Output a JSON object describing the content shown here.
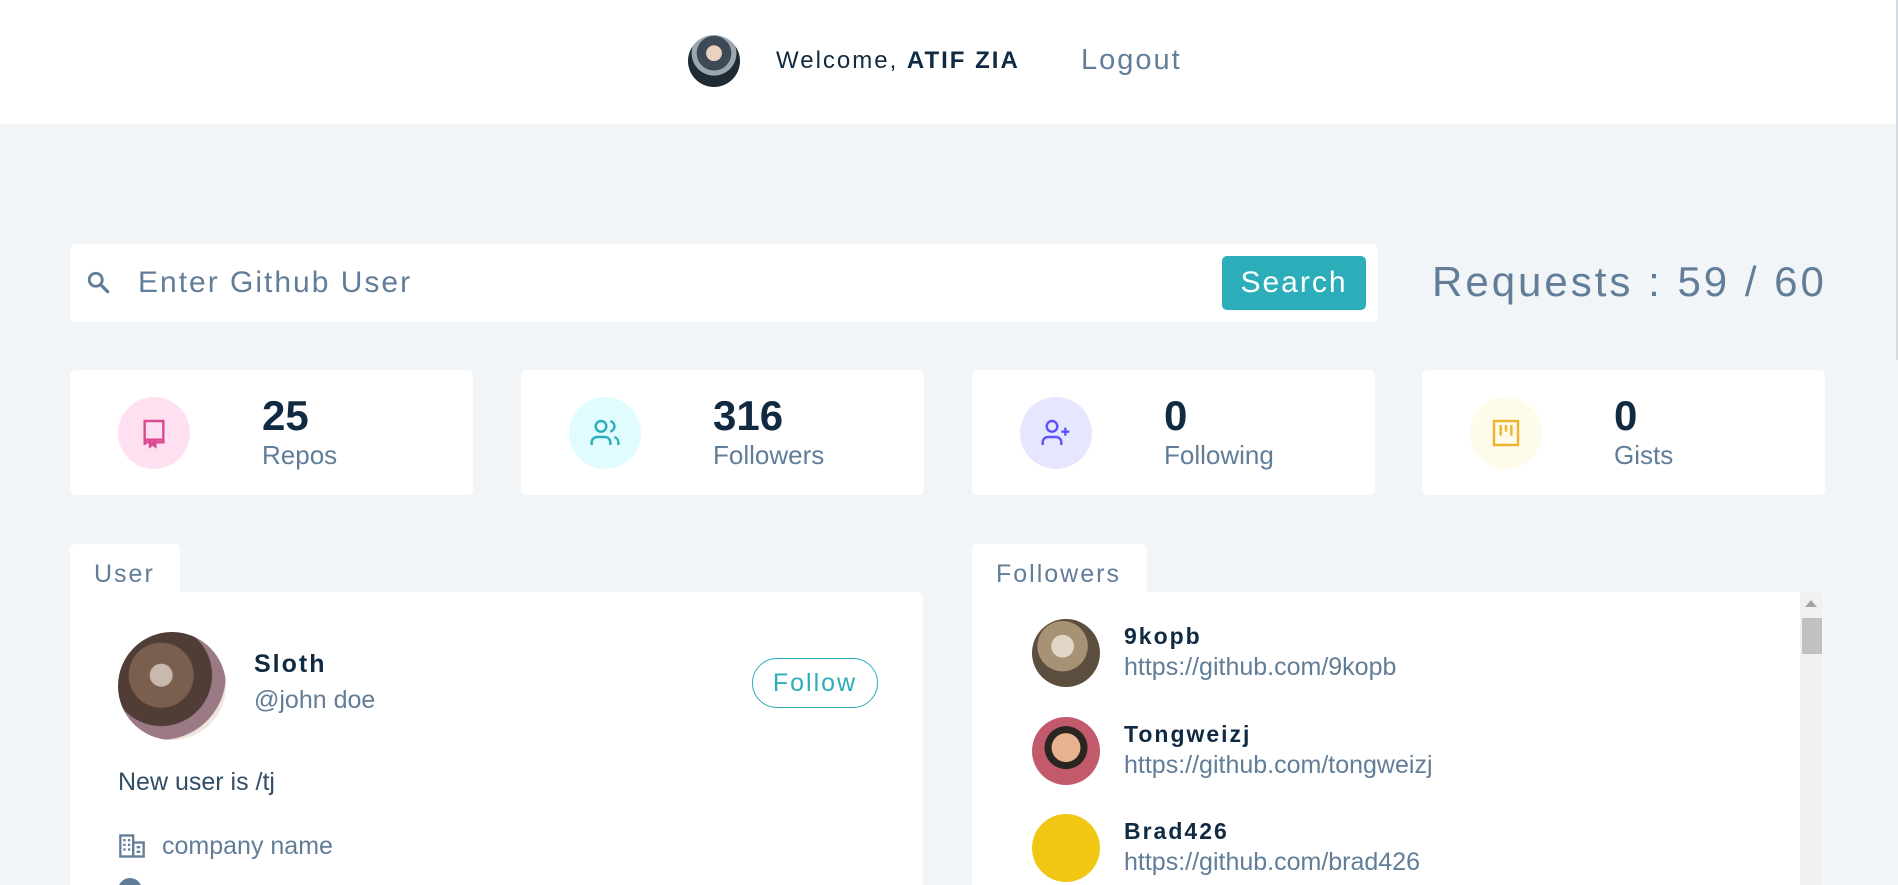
{
  "header": {
    "welcome_prefix": "Welcome, ",
    "user_name": "ATIF ZIA",
    "logout_label": "Logout"
  },
  "search": {
    "placeholder": "Enter Github User",
    "button_label": "Search",
    "requests_text": "Requests : 59 / 60"
  },
  "stats": [
    {
      "value": "25",
      "label": "Repos",
      "icon": "book-icon",
      "color": "#da4a91",
      "bg": "#ffe0f0"
    },
    {
      "value": "316",
      "label": "Followers",
      "icon": "users-icon",
      "color": "#2caeba",
      "bg": "#e0fcff"
    },
    {
      "value": "0",
      "label": "Following",
      "icon": "user-plus-icon",
      "color": "#5d55fa",
      "bg": "#e6e6ff"
    },
    {
      "value": "0",
      "label": "Gists",
      "icon": "code-icon",
      "color": "#f0b429",
      "bg": "#fffbea"
    }
  ],
  "user_panel": {
    "tab_label": "User",
    "name": "Sloth",
    "handle": "@john doe",
    "follow_label": "Follow",
    "bio": "New user is /tj",
    "company": "company name"
  },
  "followers_panel": {
    "tab_label": "Followers",
    "items": [
      {
        "name": "9kopb",
        "url": "https://github.com/9kopb"
      },
      {
        "name": "Tongweizj",
        "url": "https://github.com/tongweizj"
      },
      {
        "name": "Brad426",
        "url": "https://github.com/brad426"
      }
    ]
  }
}
